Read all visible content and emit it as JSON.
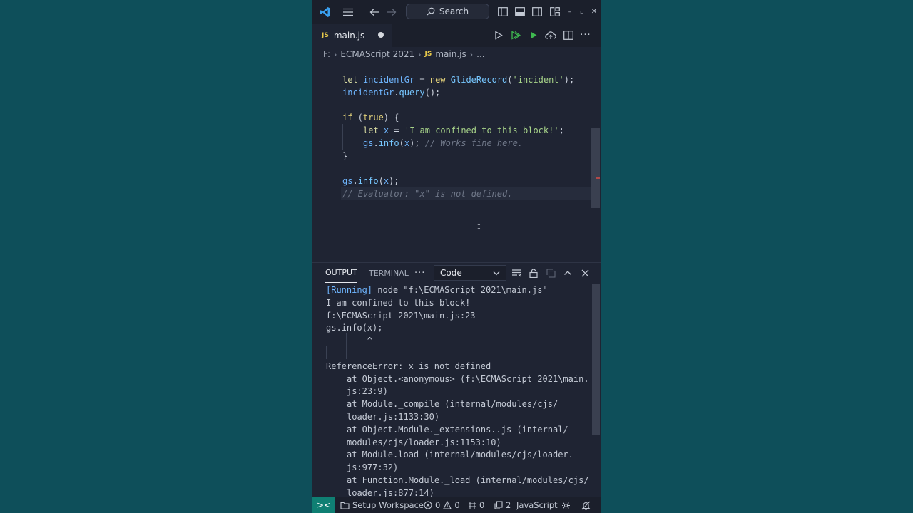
{
  "titlebar": {
    "search_label": "Search"
  },
  "tab": {
    "badge": "JS",
    "filename": "main.js"
  },
  "breadcrumb": {
    "drive": "F:",
    "folder": "ECMAScript 2021",
    "file_badge": "JS",
    "file": "main.js",
    "ellipsis": "..."
  },
  "editor": {
    "line1": {
      "kw": "let",
      "var": "incidentGr",
      "eq": " = ",
      "new": "new",
      "cls": "GlideRecord",
      "open": "(",
      "str": "'incident'",
      "close": ");"
    },
    "line2": {
      "var": "incidentGr",
      "dot": ".",
      "fn": "query",
      "rest": "();"
    },
    "line4": {
      "kw": "if",
      "open": " (",
      "val": "true",
      "close": ") {"
    },
    "line5": {
      "kw": "let",
      "var": "x",
      "eq": " = ",
      "str": "'I am confined to this block!'",
      "end": ";"
    },
    "line6": {
      "obj": "gs",
      "dot": ".",
      "fn": "info",
      "open": "(",
      "arg": "x",
      "close": "); ",
      "comment": "// Works fine here."
    },
    "line7": "}",
    "line9": {
      "obj": "gs",
      "dot": ".",
      "fn": "info",
      "open": "(",
      "arg": "x",
      "close": ");"
    },
    "line10": "// Evaluator: \"x\" is not defined."
  },
  "panel": {
    "tab_output": "OUTPUT",
    "tab_terminal": "TERMINAL",
    "more": "···",
    "select_value": "Code",
    "output": {
      "running_tag": "[Running]",
      "running_cmd": " node \"f:\\ECMAScript 2021\\main.js\"",
      "l2": "I am confined to this block!",
      "l3": "f:\\ECMAScript 2021\\main.js:23",
      "l4": "gs.info(x);",
      "l5": "        ^",
      "l6": "",
      "l7": "ReferenceError: x is not defined",
      "l8": "at Object.<anonymous> (f:\\ECMAScript 2021\\main.",
      "l9": "js:23:9)",
      "l10": "at Module._compile (internal/modules/cjs/",
      "l11": "loader.js:1133:30)",
      "l12": "at Object.Module._extensions..js (internal/",
      "l13": "modules/cjs/loader.js:1153:10)",
      "l14": "at Module.load (internal/modules/cjs/loader.",
      "l15": "js:977:32)",
      "l16": "at Function.Module._load (internal/modules/cjs/",
      "l17": "loader.js:877:14)"
    }
  },
  "status": {
    "remote_icon": "><",
    "workspace": "Setup Workspace",
    "errors": "0",
    "warnings": "0",
    "ports": "0",
    "copies": "2",
    "language": "JavaScript"
  },
  "colors": {
    "background": "#0e4f5a",
    "editor_bg": "#1f2433",
    "titlebar_bg": "#1b1f2b",
    "remote_bg": "#0f7f73",
    "run_green": "#3fb950"
  },
  "icons": [
    "vscode-logo-icon",
    "menu-icon",
    "back-arrow-icon",
    "forward-arrow-icon",
    "search-icon",
    "toggle-sidebar-icon",
    "toggle-panel-icon",
    "toggle-secondary-sidebar-icon",
    "customize-layout-icon",
    "minimize-icon",
    "restore-icon",
    "close-icon",
    "run-icon",
    "run-all-icon",
    "debug-run-icon",
    "cloud-upload-icon",
    "split-editor-icon",
    "more-actions-icon",
    "clear-output-icon",
    "lock-icon",
    "copy-icon",
    "maximize-panel-icon",
    "close-panel-icon",
    "remote-icon",
    "folder-icon",
    "error-icon",
    "warning-icon",
    "ports-icon",
    "copies-icon",
    "settings-sync-icon",
    "bell-icon"
  ]
}
